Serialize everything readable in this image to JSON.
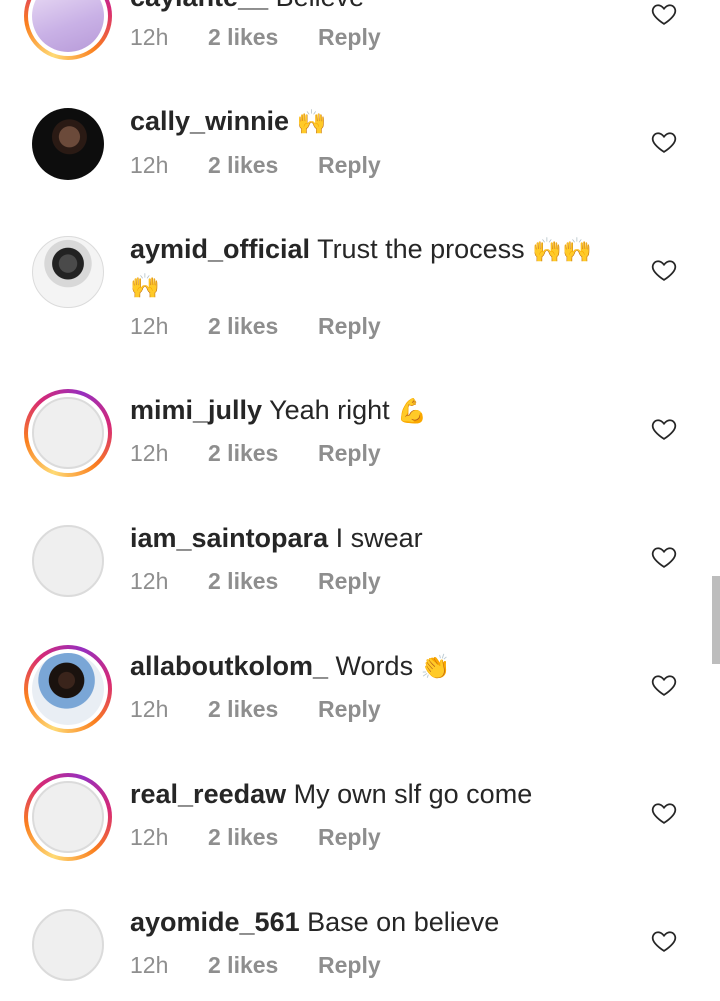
{
  "comments": [
    {
      "username": "caylante__",
      "text": "Believe",
      "emoji": "",
      "time": "12h",
      "likes": "2 likes",
      "reply": "Reply",
      "has_story_ring": true,
      "avatar": "photo-lilac"
    },
    {
      "username": "cally_winnie",
      "text": "",
      "emoji": "🙌",
      "time": "12h",
      "likes": "2 likes",
      "reply": "Reply",
      "has_story_ring": false,
      "avatar": "photo-dark"
    },
    {
      "username": "aymid_official",
      "text": "Trust the process",
      "emoji": "🙌🙌🙌",
      "time": "12h",
      "likes": "2 likes",
      "reply": "Reply",
      "has_story_ring": false,
      "avatar": "photo-bw"
    },
    {
      "username": "mimi_jully",
      "text": "Yeah right",
      "emoji": "💪",
      "time": "12h",
      "likes": "2 likes",
      "reply": "Reply",
      "has_story_ring": true,
      "avatar": "placeholder"
    },
    {
      "username": "iam_saintopara",
      "text": "I swear",
      "emoji": "",
      "time": "12h",
      "likes": "2 likes",
      "reply": "Reply",
      "has_story_ring": false,
      "avatar": "placeholder"
    },
    {
      "username": "allaboutkolom_",
      "text": "Words",
      "emoji": "👏",
      "time": "12h",
      "likes": "2 likes",
      "reply": "Reply",
      "has_story_ring": true,
      "avatar": "photo-color"
    },
    {
      "username": "real_reedaw",
      "text": "My own slf go come",
      "emoji": "",
      "time": "12h",
      "likes": "2 likes",
      "reply": "Reply",
      "has_story_ring": true,
      "avatar": "placeholder"
    },
    {
      "username": "ayomide_561",
      "text": "Base on believe",
      "emoji": "",
      "time": "12h",
      "likes": "2 likes",
      "reply": "Reply",
      "has_story_ring": false,
      "avatar": "placeholder"
    }
  ],
  "icons": {
    "like": "heart-outline-icon"
  },
  "colors": {
    "text": "#262626",
    "meta": "#8e8e8e",
    "ring_start": "#feda75",
    "ring_end": "#962fbf"
  }
}
